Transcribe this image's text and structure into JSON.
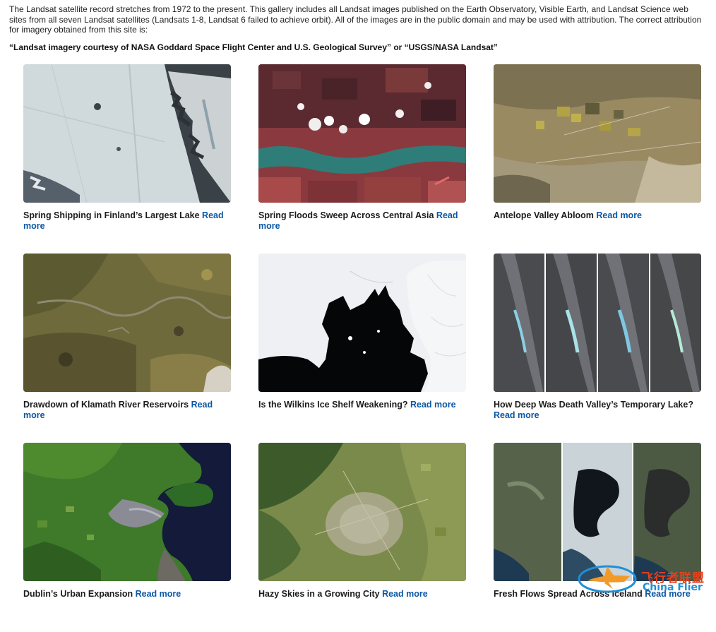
{
  "intro": {
    "text": "The Landsat satellite record stretches from 1972 to the present. This gallery includes all Landsat images published on the Earth Observatory, Visible Earth, and Landsat Science web sites from all seven Landsat satellites (Landsats 1-8, Landsat 6 failed to achieve orbit). All of the images are in the public domain and may be used with attribution. The correct attribution for imagery obtained from this site is:",
    "attribution": "“Landsat imagery courtesy of NASA Goddard Space Flight Center and U.S. Geological Survey” or “USGS/NASA Landsat”"
  },
  "gallery": {
    "read_more_label": "Read more",
    "items": [
      {
        "title": "Spring Shipping in Finland’s Largest Lake",
        "image": "frozen-lake-satellite-image"
      },
      {
        "title": "Spring Floods Sweep Across Central Asia",
        "image": "flood-river-satellite-image"
      },
      {
        "title": "Antelope Valley Abloom",
        "image": "desert-valley-satellite-image"
      },
      {
        "title": "Drawdown of Klamath River Reservoirs",
        "image": "river-reservoir-satellite-image"
      },
      {
        "title": "Is the Wilkins Ice Shelf Weakening?",
        "image": "ice-shelf-satellite-image"
      },
      {
        "title": "How Deep Was Death Valley’s Temporary Lake?",
        "image": "death-valley-time-series-image"
      },
      {
        "title": "Dublin’s Urban Expansion",
        "image": "dublin-coast-satellite-image"
      },
      {
        "title": "Hazy Skies in a Growing City",
        "image": "hazy-city-satellite-image"
      },
      {
        "title": "Fresh Flows Spread Across Iceland",
        "image": "iceland-lava-satellite-image"
      }
    ]
  },
  "watermark": {
    "cn_text": "飞行者联盟",
    "en_text": "China Flier"
  },
  "colors": {
    "link": "#0b57a4",
    "text": "#1b1b1b"
  }
}
